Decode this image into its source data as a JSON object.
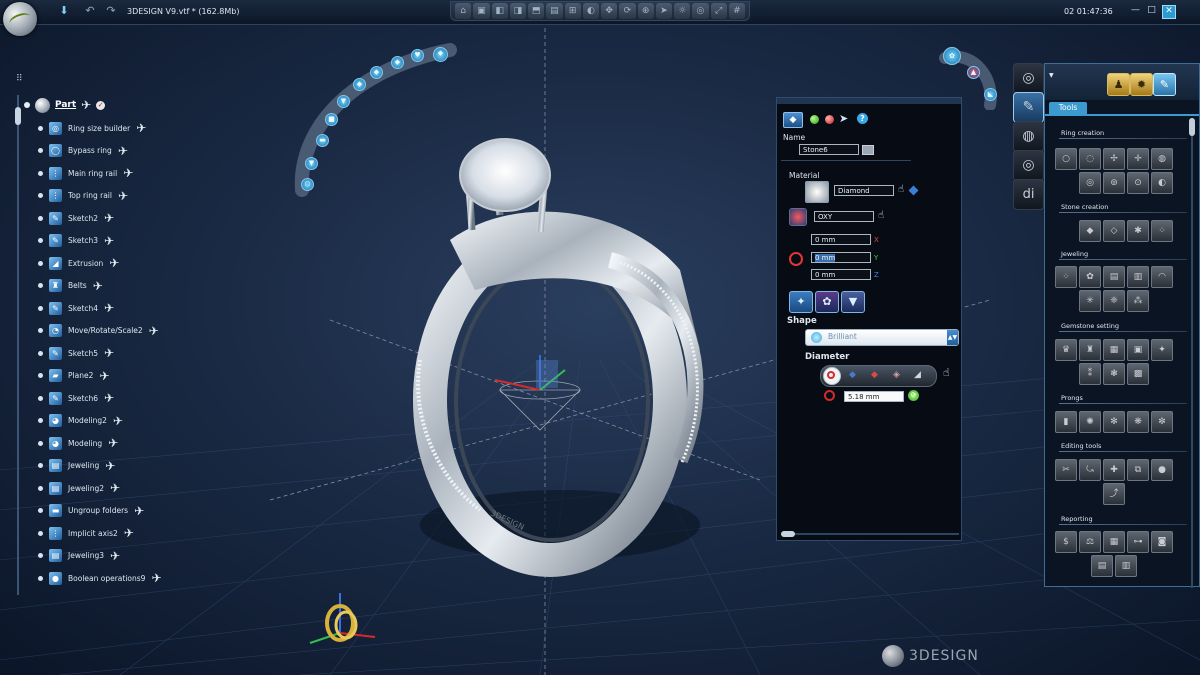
{
  "window": {
    "file_title": "3DESIGN V9.vtf * (162.8Mb)",
    "clock": "02 01:47:36"
  },
  "tree": {
    "root_label": "Part",
    "items": [
      {
        "label": "Ring size builder",
        "icon": "ring-size-icon"
      },
      {
        "label": "Bypass ring",
        "icon": "bypass-ring-icon"
      },
      {
        "label": "Main ring rail",
        "icon": "rail-icon"
      },
      {
        "label": "Top ring rail",
        "icon": "rail-icon"
      },
      {
        "label": "Sketch2",
        "icon": "sketch-icon"
      },
      {
        "label": "Sketch3",
        "icon": "sketch-icon"
      },
      {
        "label": "Extrusion",
        "icon": "extrusion-icon"
      },
      {
        "label": "Belts",
        "icon": "belts-icon"
      },
      {
        "label": "Sketch4",
        "icon": "sketch-icon"
      },
      {
        "label": "Move/Rotate/Scale2",
        "icon": "move-icon"
      },
      {
        "label": "Sketch5",
        "icon": "sketch-icon"
      },
      {
        "label": "Plane2",
        "icon": "plane-icon"
      },
      {
        "label": "Sketch6",
        "icon": "sketch-icon"
      },
      {
        "label": "Modeling2",
        "icon": "modeling-icon"
      },
      {
        "label": "Modeling",
        "icon": "modeling-icon"
      },
      {
        "label": "Jeweling",
        "icon": "jeweling-icon"
      },
      {
        "label": "Jeweling2",
        "icon": "jeweling-icon"
      },
      {
        "label": "Ungroup folders",
        "icon": "folder-icon"
      },
      {
        "label": "Implicit axis2",
        "icon": "axis-icon"
      },
      {
        "label": "Jeweling3",
        "icon": "jeweling-icon"
      },
      {
        "label": "Boolean operations9",
        "icon": "boolean-icon"
      }
    ]
  },
  "props": {
    "name_label": "Name",
    "name_value": "Stone6",
    "material_label": "Material",
    "material_value": "Diamond",
    "plane_value": "OXY",
    "x_value": "0 mm",
    "y_value": "0 mm",
    "z_value": "0 mm",
    "axis_x": "X",
    "axis_y": "Y",
    "axis_z": "Z",
    "shape_label": "Shape",
    "shape_value": "Brilliant",
    "diameter_label": "Diameter",
    "diameter_value": "5.18 mm"
  },
  "tools": {
    "tab_label": "Tools",
    "sections": {
      "ring_creation": "Ring creation",
      "stone_creation": "Stone creation",
      "jeweling": "Jeweling",
      "gemstone_setting": "Gemstone setting",
      "prongs": "Prongs",
      "editing_tools": "Editing tools",
      "reporting": "Reporting"
    }
  },
  "brand": "3DESIGN",
  "mode_icons": [
    "ring-mode-icon",
    "sketch-brush-icon",
    "render-icon",
    "ring-view-icon",
    "di-icon"
  ],
  "colors": {
    "accent": "#3b9ad0",
    "background": "#1a2a44",
    "panel": "#060b14"
  }
}
